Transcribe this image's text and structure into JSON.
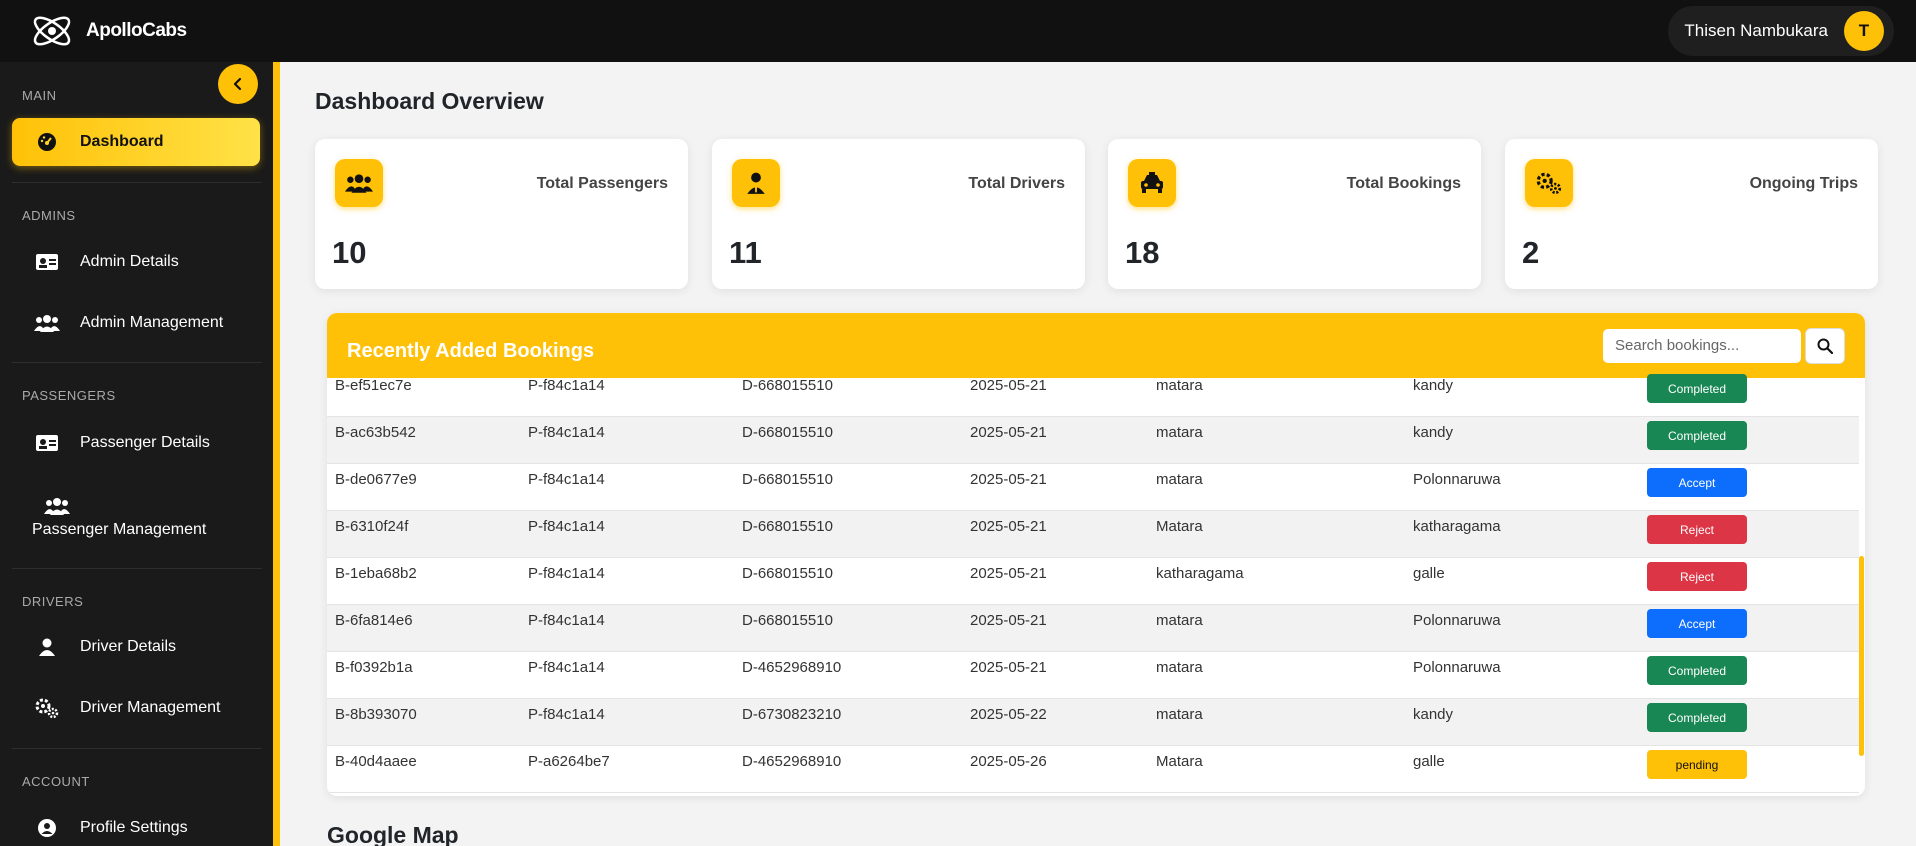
{
  "brand": {
    "name": "ApolloCabs"
  },
  "user": {
    "name": "Thisen Nambukara",
    "initial": "T"
  },
  "sidebar": {
    "sections": {
      "main": "MAIN",
      "admins": "ADMINS",
      "passengers": "PASSENGERS",
      "drivers": "DRIVERS",
      "account": "ACCOUNT"
    },
    "items": [
      {
        "label": "Dashboard",
        "icon": "dashboard-gauge-icon",
        "active": true
      },
      {
        "label": "Admin Details",
        "icon": "id-card-icon"
      },
      {
        "label": "Admin Management",
        "icon": "users-icon"
      },
      {
        "label": "Passenger Details",
        "icon": "id-card-icon"
      },
      {
        "label": "Passenger Management",
        "icon": "users-icon"
      },
      {
        "label": "Driver Details",
        "icon": "user-icon"
      },
      {
        "label": "Driver Management",
        "icon": "gears-icon"
      },
      {
        "label": "Profile Settings",
        "icon": "user-circle-icon"
      }
    ]
  },
  "main": {
    "title": "Dashboard Overview",
    "stats": [
      {
        "label": "Total Passengers",
        "value": "10",
        "icon": "users-icon"
      },
      {
        "label": "Total Drivers",
        "value": "11",
        "icon": "user-tie-icon"
      },
      {
        "label": "Total Bookings",
        "value": "18",
        "icon": "taxi-icon"
      },
      {
        "label": "Ongoing Trips",
        "value": "2",
        "icon": "gears-icon"
      }
    ],
    "bookings": {
      "title": "Recently Added Bookings",
      "search_placeholder": "Search bookings...",
      "rows": [
        [
          "B-ef51ec7e",
          "P-f84c1a14",
          "D-668015510",
          "2025-05-21",
          "matara",
          "kandy",
          "Completed"
        ],
        [
          "B-ac63b542",
          "P-f84c1a14",
          "D-668015510",
          "2025-05-21",
          "matara",
          "kandy",
          "Completed"
        ],
        [
          "B-de0677e9",
          "P-f84c1a14",
          "D-668015510",
          "2025-05-21",
          "matara",
          "Polonnaruwa",
          "Accept"
        ],
        [
          "B-6310f24f",
          "P-f84c1a14",
          "D-668015510",
          "2025-05-21",
          "Matara",
          "katharagama",
          "Reject"
        ],
        [
          "B-1eba68b2",
          "P-f84c1a14",
          "D-668015510",
          "2025-05-21",
          "katharagama",
          "galle",
          "Reject"
        ],
        [
          "B-6fa814e6",
          "P-f84c1a14",
          "D-668015510",
          "2025-05-21",
          "matara",
          "Polonnaruwa",
          "Accept"
        ],
        [
          "B-f0392b1a",
          "P-f84c1a14",
          "D-4652968910",
          "2025-05-21",
          "matara",
          "Polonnaruwa",
          "Completed"
        ],
        [
          "B-8b393070",
          "P-f84c1a14",
          "D-6730823210",
          "2025-05-22",
          "matara",
          "kandy",
          "Completed"
        ],
        [
          "B-40d4aaee",
          "P-a6264be7",
          "D-4652968910",
          "2025-05-26",
          "Matara",
          "galle",
          "pending"
        ]
      ]
    },
    "map_title": "Google Map"
  },
  "colors": {
    "accent": "#ffc107",
    "topbar": "#111111",
    "sidebar": "#1a1a1a",
    "status": {
      "Completed": "#198754",
      "Accept": "#0d6efd",
      "Reject": "#dc3545",
      "pending": "#ffc107"
    }
  }
}
